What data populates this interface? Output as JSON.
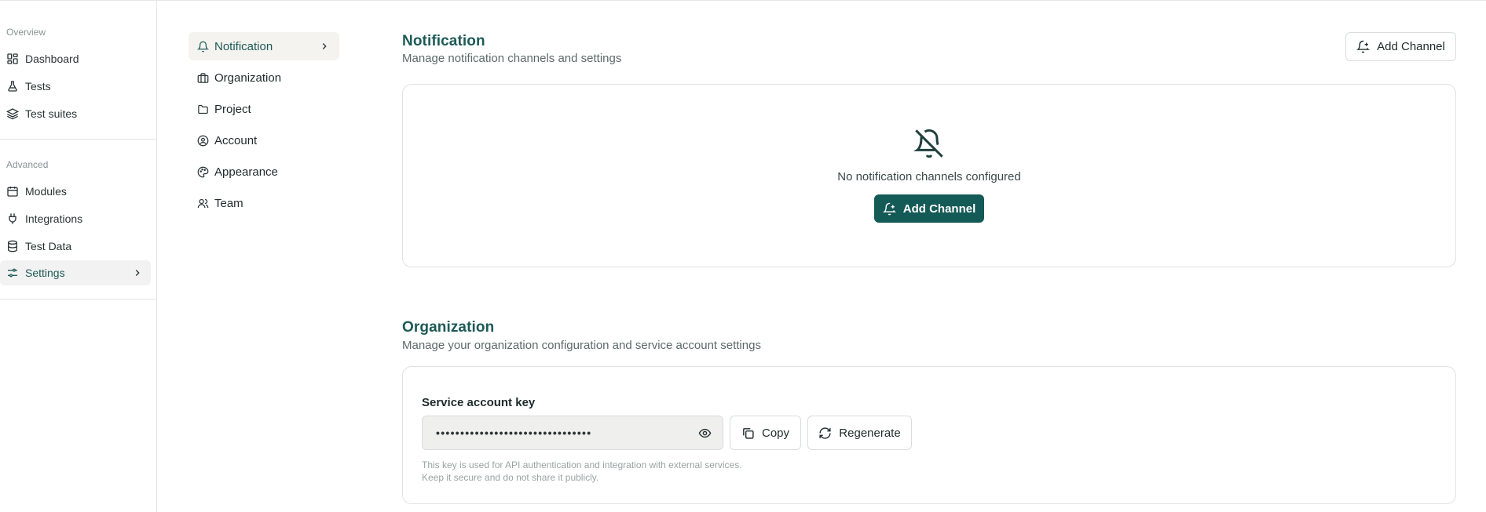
{
  "sidebar": {
    "overview_title": "Overview",
    "advanced_title": "Advanced",
    "items": [
      {
        "label": "Dashboard",
        "icon": "layout-grid-icon"
      },
      {
        "label": "Tests",
        "icon": "flask-icon"
      },
      {
        "label": "Test suites",
        "icon": "layers-icon"
      },
      {
        "label": "Modules",
        "icon": "calendar-icon"
      },
      {
        "label": "Integrations",
        "icon": "plug-icon"
      },
      {
        "label": "Test Data",
        "icon": "database-icon"
      },
      {
        "label": "Settings",
        "icon": "sliders-icon",
        "active": true
      }
    ]
  },
  "settings_nav": {
    "items": [
      {
        "label": "Notification",
        "icon": "bell-icon",
        "active": true
      },
      {
        "label": "Organization",
        "icon": "briefcase-icon"
      },
      {
        "label": "Project",
        "icon": "folder-icon"
      },
      {
        "label": "Account",
        "icon": "user-circle-icon"
      },
      {
        "label": "Appearance",
        "icon": "palette-icon"
      },
      {
        "label": "Team",
        "icon": "users-icon"
      }
    ]
  },
  "notification": {
    "title": "Notification",
    "subtitle": "Manage notification channels and settings",
    "add_button": "Add Channel",
    "empty_text": "No notification channels configured",
    "empty_button": "Add Channel"
  },
  "organization": {
    "title": "Organization",
    "subtitle": "Manage your organization configuration and service account settings",
    "key_label": "Service account key",
    "key_value": "••••••••••••••••••••••••••••••••",
    "copy_button": "Copy",
    "regenerate_button": "Regenerate",
    "help_line_1": "This key is used for API authentication and integration with external services.",
    "help_line_2": "Keep it secure and do not share it publicly."
  },
  "colors": {
    "accent": "#145a57",
    "heading": "#1d5a57",
    "active_bg": "#f1f2f1"
  }
}
